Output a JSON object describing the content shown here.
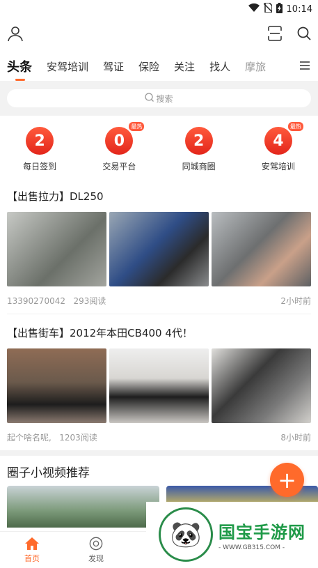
{
  "status_bar": {
    "time": "10:14"
  },
  "tabs": [
    {
      "label": "头条",
      "active": true
    },
    {
      "label": "安驾培训"
    },
    {
      "label": "驾证"
    },
    {
      "label": "保险"
    },
    {
      "label": "关注"
    },
    {
      "label": "找人"
    },
    {
      "label": "摩旅"
    }
  ],
  "search": {
    "placeholder": "搜索"
  },
  "quick": [
    {
      "num": "2",
      "label": "每日签到",
      "hot": ""
    },
    {
      "num": "0",
      "label": "交易平台",
      "hot": "最热"
    },
    {
      "num": "2",
      "label": "同城商圈",
      "hot": ""
    },
    {
      "num": "4",
      "label": "安驾培训",
      "hot": "最热"
    }
  ],
  "posts": [
    {
      "title": "【出售拉力】DL250",
      "author": "13390270042",
      "views": "293阅读",
      "time": "2小时前",
      "image_colors": [
        "#9aa09a",
        "#5e6f86",
        "#8b8f91"
      ]
    },
    {
      "title": "【出售街车】2012年本田CB400 4代！",
      "author": "起个啥名呢,",
      "views": "1203阅读",
      "time": "8小时前",
      "image_colors": [
        "#8a6a55",
        "#d8d6d2",
        "#c9c6c2"
      ]
    }
  ],
  "video_section": {
    "title": "圈子小视频推荐"
  },
  "nav": [
    {
      "label": "首页",
      "active": true
    },
    {
      "label": "发现"
    }
  ],
  "watermark": {
    "brand": "国宝手游网",
    "url": "- WWW.GB315.COM -"
  },
  "colors": {
    "accent": "#ff6a2b",
    "coin": "#e3261b"
  }
}
